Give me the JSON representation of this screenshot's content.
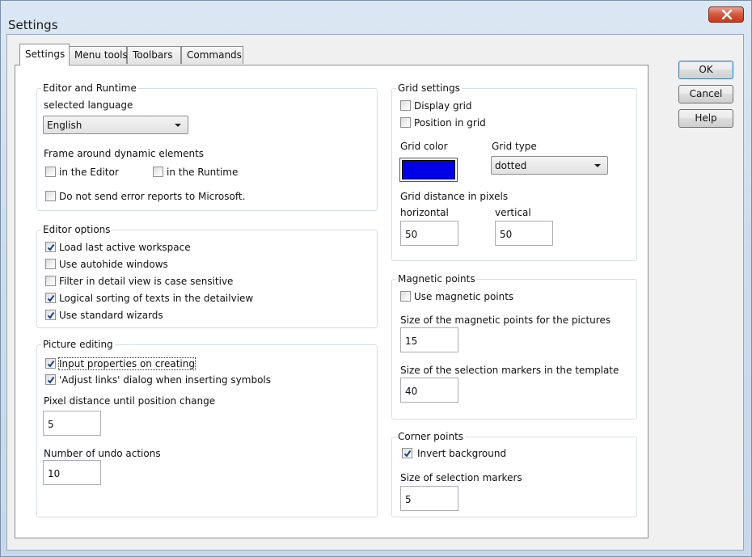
{
  "window": {
    "title": "Settings"
  },
  "tabs": [
    {
      "label": "Settings",
      "active": true
    },
    {
      "label": "Menu tools",
      "active": false
    },
    {
      "label": "Toolbars",
      "active": false
    },
    {
      "label": "Commands",
      "active": false
    }
  ],
  "buttons": {
    "ok": "OK",
    "cancel": "Cancel",
    "help": "Help"
  },
  "editor_runtime": {
    "legend": "Editor and Runtime",
    "language_label": "selected language",
    "language_value": "English",
    "frame_label": "Frame around dynamic elements",
    "in_editor": {
      "label": "in the Editor",
      "checked": false
    },
    "in_runtime": {
      "label": "in the Runtime",
      "checked": false
    },
    "no_error_reports": {
      "label": "Do not send error reports to Microsoft.",
      "checked": false
    }
  },
  "editor_options": {
    "legend": "Editor options",
    "items": [
      {
        "label": "Load last active workspace",
        "checked": true
      },
      {
        "label": "Use autohide windows",
        "checked": false
      },
      {
        "label": "Filter in detail view is case sensitive",
        "checked": false
      },
      {
        "label": "Logical sorting of texts in the detailview",
        "checked": true
      },
      {
        "label": "Use standard wizards",
        "checked": true
      }
    ]
  },
  "picture_editing": {
    "legend": "Picture editing",
    "items": [
      {
        "label": "Input properties on creating",
        "checked": true
      },
      {
        "label": "'Adjust links' dialog when inserting symbols",
        "checked": true
      }
    ],
    "pixel_distance_label": "Pixel distance until position change",
    "pixel_distance_value": "5",
    "undo_label": "Number of undo actions",
    "undo_value": "10"
  },
  "grid_settings": {
    "legend": "Grid settings",
    "display_grid": {
      "label": "Display grid",
      "checked": false
    },
    "position_in_grid": {
      "label": "Position in grid",
      "checked": false
    },
    "color_label": "Grid color",
    "color_value": "#0000e6",
    "type_label": "Grid type",
    "type_value": "dotted",
    "distance_label": "Grid distance in pixels",
    "horizontal_label": "horizontal",
    "horizontal_value": "50",
    "vertical_label": "vertical",
    "vertical_value": "50"
  },
  "magnetic_points": {
    "legend": "Magnetic points",
    "use": {
      "label": "Use magnetic points",
      "checked": false
    },
    "size_pictures_label": "Size of the magnetic points for the pictures",
    "size_pictures_value": "15",
    "size_markers_label": "Size of the selection markers in the template",
    "size_markers_value": "40"
  },
  "corner_points": {
    "legend": "Corner points",
    "invert": {
      "label": "Invert background",
      "checked": true
    },
    "size_label": "Size of selection markers",
    "size_value": "5"
  },
  "colors": {
    "check": "#1d3e8a",
    "close_accent": "#c23c1c"
  }
}
